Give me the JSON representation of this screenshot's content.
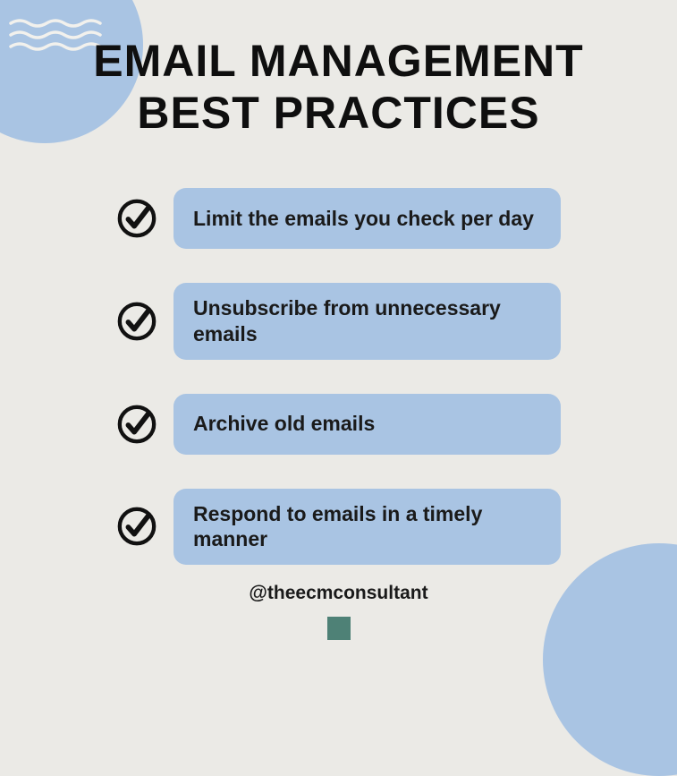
{
  "title_line1": "EMAIL MANAGEMENT",
  "title_line2": "BEST PRACTICES",
  "items": [
    {
      "text": "Limit the emails you check per day"
    },
    {
      "text": "Unsubscribe from unnecessary emails"
    },
    {
      "text": "Archive old emails"
    },
    {
      "text": "Respond to emails in a timely manner"
    }
  ],
  "handle": "@theecmconsultant"
}
